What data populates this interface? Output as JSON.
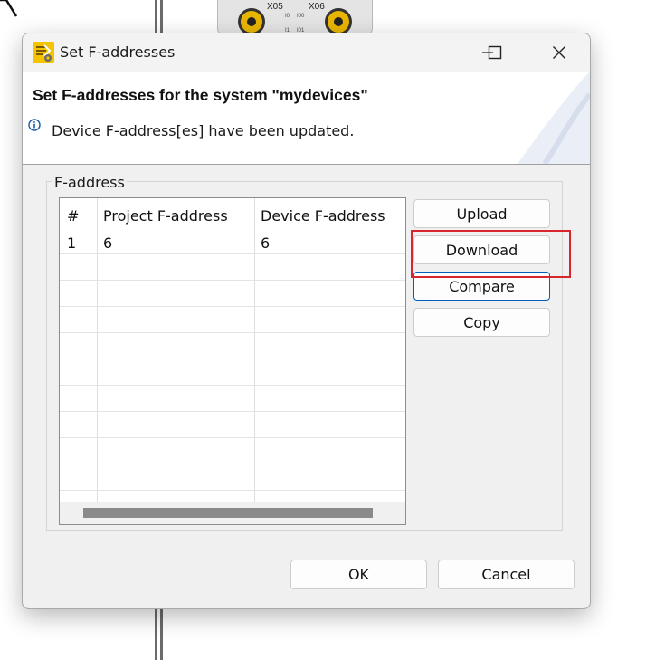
{
  "background": {
    "connector_labels": [
      "X05",
      "X06"
    ],
    "pin_labels": [
      "I0",
      "I00",
      "I1",
      "I01"
    ]
  },
  "window": {
    "title": "Set F-addresses",
    "icon": "app-icon",
    "controls": [
      "minimize-icon",
      "maximize-icon",
      "close-icon"
    ]
  },
  "header": {
    "title": "Set F-addresses for the system \"mydevices\"",
    "message_icon": "info-icon",
    "message": "Device F-address[es] have been updated."
  },
  "group": {
    "label": "F-address",
    "table": {
      "columns": [
        "#",
        "Project F-address",
        "Device F-address"
      ],
      "rows": [
        {
          "index": "1",
          "project": "6",
          "device": "6"
        }
      ]
    },
    "actions": {
      "upload": "Upload",
      "download": "Download",
      "compare": "Compare",
      "copy": "Copy"
    }
  },
  "footer": {
    "ok": "OK",
    "cancel": "Cancel"
  },
  "colors": {
    "highlight": "#d9262e",
    "focus": "#005fb8",
    "info": "#1e5aa8"
  }
}
